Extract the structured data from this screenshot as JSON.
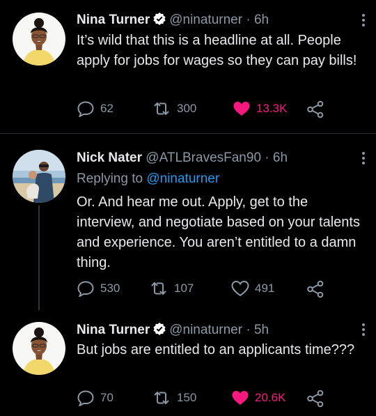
{
  "tweets": [
    {
      "name": "Nina Turner",
      "handle": "@ninaturner",
      "dot": "·",
      "time": "6h",
      "text": "It’s wild that this is a headline at all. People apply for jobs for wages so they can pay bills!",
      "replies": "62",
      "retweets": "300",
      "likes": "13.3K"
    },
    {
      "name": "Nick Nater",
      "handle": "@ATLBravesFan90",
      "dot": "·",
      "time": "6h",
      "replying_prefix": "Replying to",
      "replying_to": "@ninaturner",
      "text": "Or. And hear me out. Apply, get to the interview, and negotiate based on your talents and experience. You aren’t entitled to a damn thing.",
      "replies": "530",
      "retweets": "107",
      "likes": "491"
    },
    {
      "name": "Nina Turner",
      "handle": "@ninaturner",
      "dot": "·",
      "time": "5h",
      "text": "But jobs are entitled to an applicants time???",
      "replies": "70",
      "retweets": "150",
      "likes": "20.6K"
    }
  ],
  "colors": {
    "background": "#000000",
    "text": "#e7e9ea",
    "muted": "#8b98a5",
    "link": "#1d9bf0",
    "like": "#f91880",
    "verified": "#ffffff"
  },
  "icons": [
    "verified-badge-icon",
    "more-icon",
    "reply-icon",
    "retweet-icon",
    "heart-icon",
    "share-icon"
  ]
}
